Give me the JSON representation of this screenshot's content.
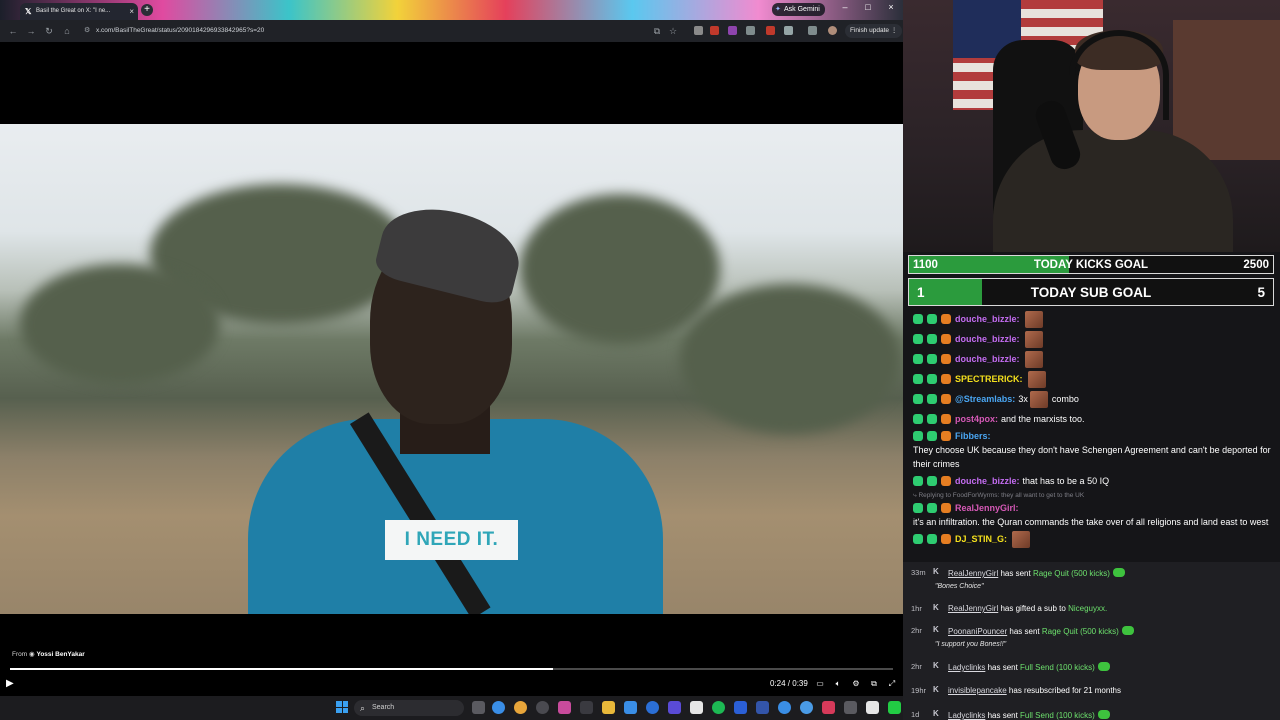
{
  "browser": {
    "tab_title": "Basil the Great on X: \"I ne...",
    "ask_gemini": "Ask Gemini",
    "url": "x.com/BasilTheGreat/status/2090184296933842965?s=20",
    "finish_update": "Finish update"
  },
  "video": {
    "subtitle": "I NEED IT.",
    "from_prefix": "From",
    "from_user": "Yossi BenYakar",
    "time": "0:24 / 0:39",
    "progress_fraction": 0.6154
  },
  "taskbar": {
    "search_label": "Search"
  },
  "goals": {
    "kicks": {
      "current": "1100",
      "title": "TODAY KICKS GOAL",
      "target": "2500",
      "fill_fraction": 0.44,
      "fill_color": "#2b9b3d"
    },
    "subs": {
      "current": "1",
      "title": "TODAY SUB GOAL",
      "target": "5",
      "fill_fraction": 0.2,
      "fill_color": "#2b9b3d"
    }
  },
  "chat": {
    "messages": [
      {
        "user": "douche_bizzle",
        "sep": ":",
        "text": "",
        "color": "#c36cf0",
        "emote": true
      },
      {
        "user": "douche_bizzle",
        "sep": ":",
        "text": "",
        "color": "#c36cf0",
        "emote": true
      },
      {
        "user": "douche_bizzle",
        "sep": ":",
        "text": "",
        "color": "#c36cf0",
        "emote": true
      },
      {
        "user": "SPECTRERICK",
        "sep": ":",
        "text": "",
        "color": "#f5e11d",
        "emote": true
      },
      {
        "user": "@Streamlabs",
        "sep": ":",
        "text": "3x",
        "after": "combo",
        "color": "#4aa6f2",
        "emote": true
      },
      {
        "user": "post4pox",
        "sep": ":",
        "text": "and the marxists too.",
        "color": "#d659b7",
        "emote": false
      },
      {
        "user": "Fibbers",
        "sep": ":",
        "text": "They choose UK because they don't have Schengen Agreement and can't be deported for their crimes",
        "color": "#4aa6f2",
        "emote": false
      },
      {
        "user": "douche_bizzle",
        "sep": ":",
        "text": "that has to be a 50 IQ",
        "color": "#c36cf0",
        "emote": false
      },
      {
        "reply": "Replying to FoodForWyrms: they all want to get to the UK"
      },
      {
        "user": "RealJennyGirl",
        "sep": ":",
        "text": "it's an infiltration. the Quran commands the take over of all religions and land east to west",
        "color": "#d659b7",
        "emote": false
      },
      {
        "user": "DJ_STIN_G",
        "sep": ":",
        "text": "",
        "color": "#f5e11d",
        "emote": true
      }
    ]
  },
  "events": [
    {
      "time": "33m",
      "user": "RealJennyGirl",
      "action": "has sent",
      "item": "Rage Quit (500 kicks)",
      "note": "\"Bones Choice\"",
      "icon": true
    },
    {
      "time": "1hr",
      "user": "RealJennyGirl",
      "action": "has gifted a sub to",
      "item": "Niceguyxx.",
      "note": "",
      "icon": false
    },
    {
      "time": "2hr",
      "user": "PoonaniPouncer",
      "action": "has sent",
      "item": "Rage Quit (500 kicks)",
      "note": "\"I support you Bones!!\"",
      "icon": true
    },
    {
      "time": "2hr",
      "user": "Ladyclinks",
      "action": "has sent",
      "item": "Full Send (100 kicks)",
      "note": "",
      "icon": true
    },
    {
      "time": "19hr",
      "user": "invisiblepancake",
      "action": "has resubscribed for 21 months",
      "item": "",
      "note": "",
      "icon": false
    },
    {
      "time": "1d",
      "user": "Ladyclinks",
      "action": "has sent",
      "item": "Full Send (100 kicks)",
      "note": "",
      "icon": true
    }
  ]
}
